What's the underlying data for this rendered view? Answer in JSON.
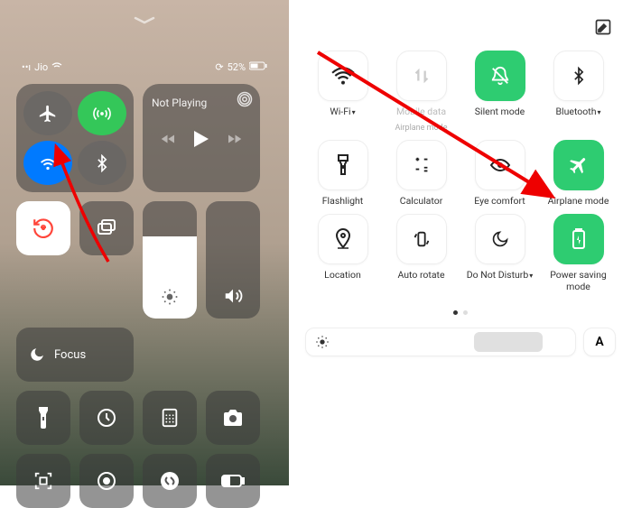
{
  "ios": {
    "carrier": "Jio",
    "battery": "52%",
    "now_playing": "Not Playing",
    "focus_label": "Focus"
  },
  "android": {
    "tiles": [
      {
        "label": "Wi-Fi",
        "sub": "",
        "dropdown": true,
        "on": false,
        "icon": "wifi"
      },
      {
        "label": "Mobile data",
        "sub": "Airplane mode",
        "dropdown": false,
        "on": false,
        "icon": "data"
      },
      {
        "label": "Silent mode",
        "sub": "",
        "dropdown": false,
        "on": true,
        "icon": "bell-off"
      },
      {
        "label": "Bluetooth",
        "sub": "",
        "dropdown": true,
        "on": false,
        "icon": "bluetooth"
      },
      {
        "label": "Flashlight",
        "sub": "",
        "dropdown": false,
        "on": false,
        "icon": "flashlight"
      },
      {
        "label": "Calculator",
        "sub": "",
        "dropdown": false,
        "on": false,
        "icon": "calculator"
      },
      {
        "label": "Eye comfort",
        "sub": "",
        "dropdown": false,
        "on": false,
        "icon": "eye"
      },
      {
        "label": "Airplane mode",
        "sub": "",
        "dropdown": false,
        "on": true,
        "icon": "airplane"
      },
      {
        "label": "Location",
        "sub": "",
        "dropdown": false,
        "on": false,
        "icon": "location"
      },
      {
        "label": "Auto rotate",
        "sub": "",
        "dropdown": false,
        "on": false,
        "icon": "rotate"
      },
      {
        "label": "Do Not Disturb",
        "sub": "",
        "dropdown": true,
        "on": false,
        "icon": "moon"
      },
      {
        "label": "Power saving mode",
        "sub": "",
        "dropdown": false,
        "on": true,
        "icon": "battery"
      }
    ],
    "auto_brightness": "A"
  }
}
